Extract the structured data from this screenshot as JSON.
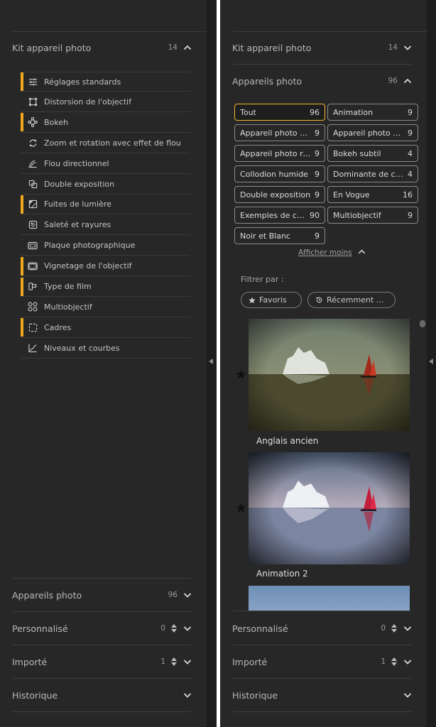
{
  "left": {
    "kit": {
      "title": "Kit appareil photo",
      "count": "14"
    },
    "items": [
      {
        "label": "Réglages standards",
        "active": true,
        "icon": "sliders-icon"
      },
      {
        "label": "Distorsion de l'objectif",
        "active": false,
        "icon": "distortion-icon"
      },
      {
        "label": "Bokeh",
        "active": true,
        "icon": "bokeh-icon"
      },
      {
        "label": "Zoom et rotation avec effet de flou",
        "active": false,
        "icon": "rotate-icon"
      },
      {
        "label": "Flou directionnel",
        "active": false,
        "icon": "motion-blur-icon"
      },
      {
        "label": "Double exposition",
        "active": false,
        "icon": "double-exposure-icon"
      },
      {
        "label": "Fuites de lumière",
        "active": true,
        "icon": "light-leak-icon"
      },
      {
        "label": "Saleté et rayures",
        "active": false,
        "icon": "scratches-icon"
      },
      {
        "label": "Plaque photographique",
        "active": false,
        "icon": "plate-icon"
      },
      {
        "label": "Vignetage de l'objectif",
        "active": true,
        "icon": "vignette-icon"
      },
      {
        "label": "Type de film",
        "active": true,
        "icon": "film-type-icon"
      },
      {
        "label": "Multiobjectif",
        "active": false,
        "icon": "multilens-icon"
      },
      {
        "label": "Cadres",
        "active": true,
        "icon": "frames-icon"
      },
      {
        "label": "Niveaux et courbes",
        "active": false,
        "icon": "curves-icon"
      }
    ],
    "appareils": {
      "title": "Appareils photo",
      "count": "96"
    },
    "perso": {
      "title": "Personnalisé",
      "count": "0"
    },
    "importe": {
      "title": "Importé",
      "count": "1"
    },
    "historique": {
      "title": "Historique"
    }
  },
  "right": {
    "kit": {
      "title": "Kit appareil photo",
      "count": "14"
    },
    "appareils": {
      "title": "Appareils photo",
      "count": "96"
    },
    "chips": [
      {
        "label": "Tout",
        "count": "96",
        "selected": true
      },
      {
        "label": "Animation",
        "count": "9"
      },
      {
        "label": "Appareil photo bo...",
        "count": "9"
      },
      {
        "label": "Appareil photo cla...",
        "count": "9"
      },
      {
        "label": "Appareil photo rétro",
        "count": "9"
      },
      {
        "label": "Bokeh subtil",
        "count": "4"
      },
      {
        "label": "Collodion humide",
        "count": "9"
      },
      {
        "label": "Dominante de co...",
        "count": "4"
      },
      {
        "label": "Double exposition",
        "count": "9"
      },
      {
        "label": "En Vogue",
        "count": "16"
      },
      {
        "label": "Exemples de co...",
        "count": "90"
      },
      {
        "label": "Multiobjectif",
        "count": "9"
      },
      {
        "label": "Noir et Blanc",
        "count": "9"
      }
    ],
    "show_less": "Afficher moins",
    "filter_label": "Filtrer par :",
    "filter_favorites": "Favoris",
    "filter_recent": "Récemment ...",
    "presets": [
      {
        "name": "Anglais ancien"
      },
      {
        "name": "Animation 2"
      }
    ],
    "perso": {
      "title": "Personnalisé",
      "count": "0"
    },
    "importe": {
      "title": "Importé",
      "count": "1"
    },
    "historique": {
      "title": "Historique"
    }
  },
  "colors": {
    "accent": "#f0a91e",
    "panel": "#272727",
    "gutter": "#1d1d1d"
  }
}
